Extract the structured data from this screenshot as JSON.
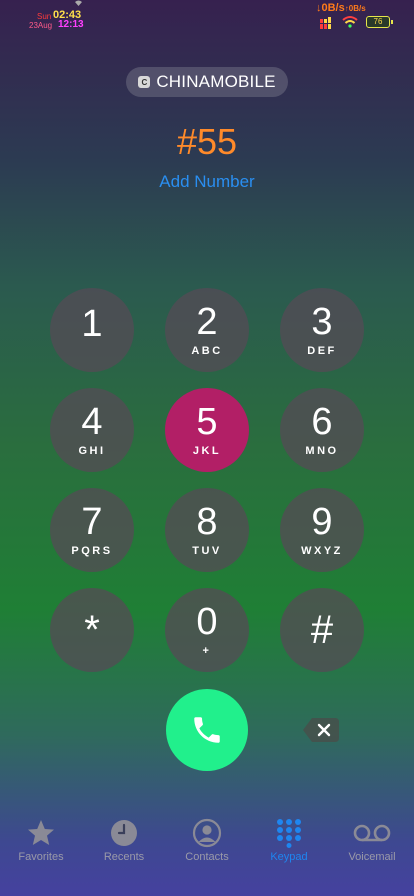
{
  "status_bar": {
    "day": "Sun",
    "time": "02:43",
    "date": "23Aug",
    "time2": "12:13",
    "net_down": "↓0B/s",
    "net_up": "↑0B/s",
    "battery": "76"
  },
  "carrier": {
    "icon_letter": "C",
    "name": "CHINAMOBILE"
  },
  "dialer": {
    "number": "#55",
    "add_number": "Add Number",
    "pressed_key": "5"
  },
  "keypad": [
    {
      "digit": "1",
      "letters": ""
    },
    {
      "digit": "2",
      "letters": "ABC"
    },
    {
      "digit": "3",
      "letters": "DEF"
    },
    {
      "digit": "4",
      "letters": "GHI"
    },
    {
      "digit": "5",
      "letters": "JKL"
    },
    {
      "digit": "6",
      "letters": "MNO"
    },
    {
      "digit": "7",
      "letters": "PQRS"
    },
    {
      "digit": "8",
      "letters": "TUV"
    },
    {
      "digit": "9",
      "letters": "WXYZ"
    },
    {
      "digit": "*",
      "letters": ""
    },
    {
      "digit": "0",
      "letters": "+"
    },
    {
      "digit": "#",
      "letters": ""
    }
  ],
  "tabs": [
    {
      "label": "Favorites",
      "icon": "star-icon",
      "active": false
    },
    {
      "label": "Recents",
      "icon": "clock-icon",
      "active": false
    },
    {
      "label": "Contacts",
      "icon": "person-icon",
      "active": false
    },
    {
      "label": "Keypad",
      "icon": "keypad-icon",
      "active": true
    },
    {
      "label": "Voicemail",
      "icon": "voicemail-icon",
      "active": false
    }
  ],
  "colors": {
    "pressed_key": "#b21f66",
    "call_button": "#21f08c",
    "accent": "#1e86f0",
    "dialed_number": "#ff8a2a"
  }
}
